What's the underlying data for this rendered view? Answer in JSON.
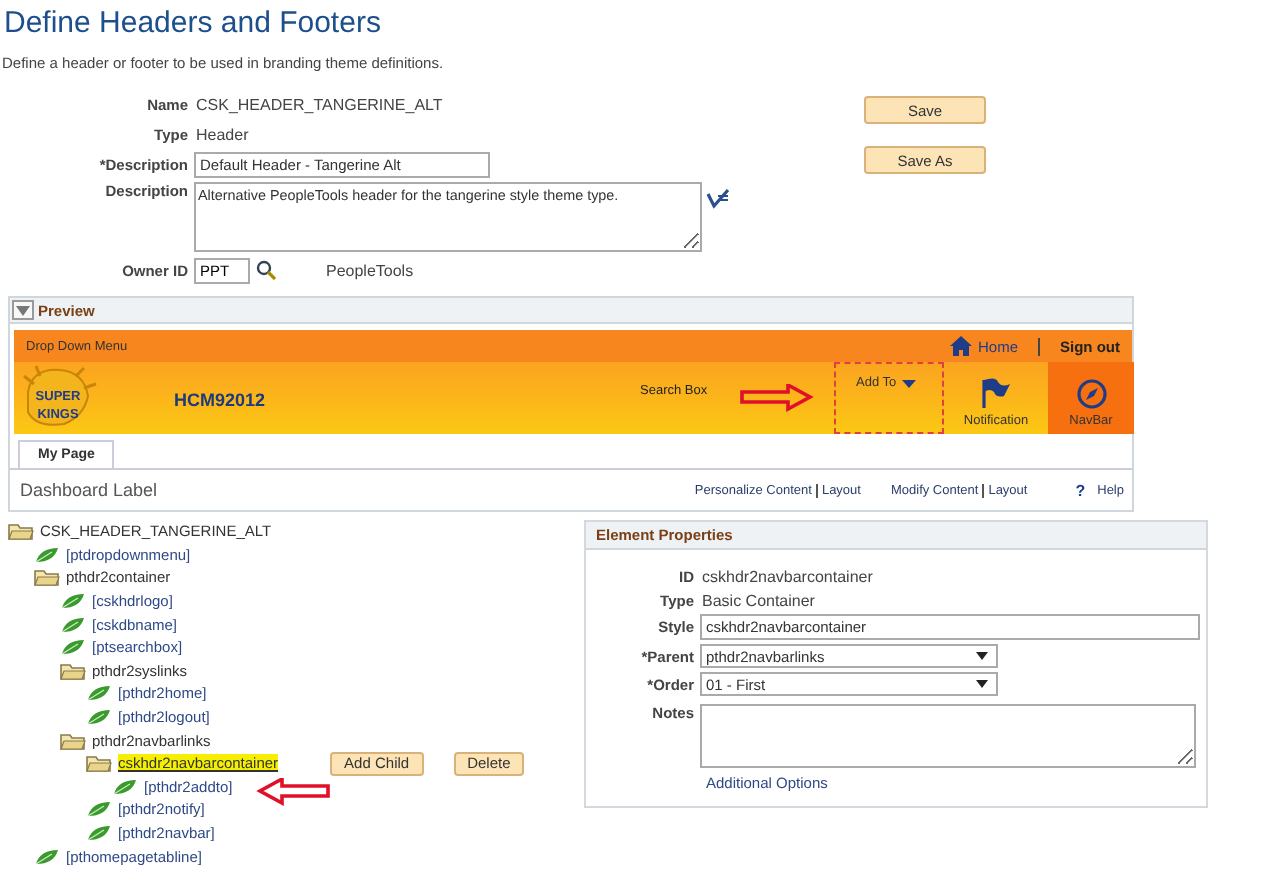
{
  "page": {
    "title": "Define Headers and Footers",
    "subtitle": "Define a header or footer to be used in branding theme definitions."
  },
  "form": {
    "fields": [
      {
        "label": "Name",
        "kind": "display",
        "value": "CSK_HEADER_TANGERINE_ALT"
      },
      {
        "label": "Type",
        "kind": "display",
        "value": "Header"
      },
      {
        "label": "*Description",
        "kind": "input",
        "value": "Default Header - Tangerine Alt"
      },
      {
        "label": "Description",
        "kind": "textarea",
        "value": "Alternative PeopleTools header for the tangerine style theme type."
      },
      {
        "label": "Owner ID",
        "kind": "lookup",
        "value": "PPT",
        "note": "PeopleTools"
      }
    ],
    "buttons": [
      "Save",
      "Save As"
    ]
  },
  "preview": {
    "title": "Preview",
    "expanded": true,
    "header": {
      "menu": "Drop Down Menu",
      "home": "Home",
      "signout": "Sign out",
      "logo_text": [
        "SUPER",
        "KINGS"
      ],
      "db_name": "HCM92012",
      "search": "Search Box",
      "add_to": "Add To",
      "notification": "Notification",
      "navbar": "NavBar"
    },
    "tabs": [
      {
        "label": "My Page",
        "selected": true
      }
    ],
    "dashboard": {
      "label": "Dashboard Label",
      "links": [
        {
          "first": "Personalize Content",
          "second": "Layout"
        },
        {
          "first": "Modify Content",
          "second": "Layout"
        }
      ],
      "help_icon": "?",
      "help": "Help"
    }
  },
  "tree": [
    {
      "label": "CSK_HEADER_TANGERINE_ALT",
      "kind": "folder",
      "selected": false,
      "children": [
        {
          "label": "[ptdropdownmenu]",
          "kind": "leaf",
          "selected": false
        },
        {
          "label": "pthdr2container",
          "kind": "folder",
          "selected": false,
          "children": [
            {
              "label": "[cskhdrlogo]",
              "kind": "leaf",
              "selected": false
            },
            {
              "label": "[cskdbname]",
              "kind": "leaf",
              "selected": false
            },
            {
              "label": "[ptsearchbox]",
              "kind": "leaf",
              "selected": false
            },
            {
              "label": "pthdr2syslinks",
              "kind": "folder",
              "selected": false,
              "children": [
                {
                  "label": "[pthdr2home]",
                  "kind": "leaf",
                  "selected": false
                },
                {
                  "label": "[pthdr2logout]",
                  "kind": "leaf",
                  "selected": false
                }
              ]
            },
            {
              "label": "pthdr2navbarlinks",
              "kind": "folder",
              "selected": false,
              "children": [
                {
                  "label": "cskhdr2navbarcontainer",
                  "kind": "folder",
                  "selected": true,
                  "actions": [
                    "Add Child",
                    "Delete"
                  ],
                  "children": [
                    {
                      "label": "[pthdr2addto]",
                      "kind": "leaf",
                      "selected": false
                    }
                  ]
                },
                {
                  "label": "[pthdr2notify]",
                  "kind": "leaf",
                  "selected": false
                },
                {
                  "label": "[pthdr2navbar]",
                  "kind": "leaf",
                  "selected": false
                }
              ]
            }
          ]
        },
        {
          "label": "[pthomepagetabline]",
          "kind": "leaf",
          "selected": false
        }
      ]
    }
  ],
  "properties": {
    "title": "Element Properties",
    "fields": [
      {
        "label": "ID",
        "kind": "display",
        "value": "cskhdr2navbarcontainer"
      },
      {
        "label": "Type",
        "kind": "display",
        "value": "Basic Container"
      },
      {
        "label": "Style",
        "kind": "input",
        "value": "cskhdr2navbarcontainer"
      },
      {
        "label": "*Parent",
        "kind": "select",
        "value": "pthdr2navbarlinks"
      },
      {
        "label": "*Order",
        "kind": "select",
        "value": "01 - First"
      },
      {
        "label": "Notes",
        "kind": "textarea"
      }
    ],
    "link": "Additional Options"
  }
}
